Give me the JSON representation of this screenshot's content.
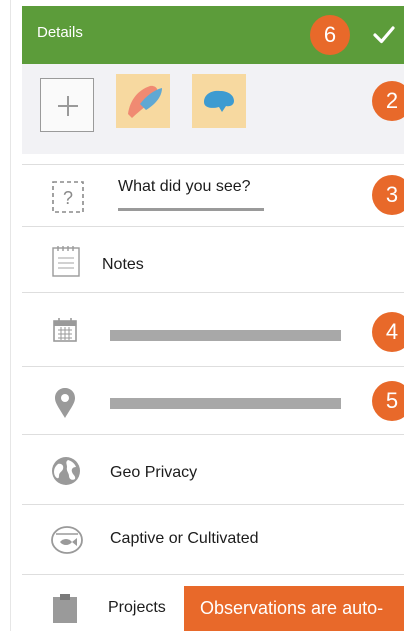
{
  "header": {
    "title": "Details",
    "badge": "6",
    "confirm_icon": "checkmark-icon"
  },
  "photos": {
    "add_icon": "plus-icon",
    "badge": "2",
    "thumbnails": [
      {
        "icon": "photo-thumbnail-icon",
        "color": "#f7d9a0"
      },
      {
        "icon": "photo-thumbnail-icon",
        "color": "#f7d9a0"
      }
    ]
  },
  "species": {
    "icon": "unknown-species-icon",
    "prompt": "What did you see?",
    "badge": "3"
  },
  "notes": {
    "icon": "notes-icon",
    "label": "Notes"
  },
  "date": {
    "icon": "calendar-icon",
    "badge": "4"
  },
  "location": {
    "icon": "location-pin-icon",
    "badge": "5"
  },
  "geoprivacy": {
    "icon": "globe-icon",
    "label": "Geo Privacy"
  },
  "captive": {
    "icon": "fishbowl-icon",
    "label": "Captive or Cultivated"
  },
  "projects": {
    "icon": "clipboard-icon",
    "label": "Projects"
  },
  "toast": {
    "text": "Observations are auto-"
  },
  "colors": {
    "header_green": "#5c9c3a",
    "accent_orange": "#e8692a",
    "placeholder_grey": "#a8a8a8"
  }
}
